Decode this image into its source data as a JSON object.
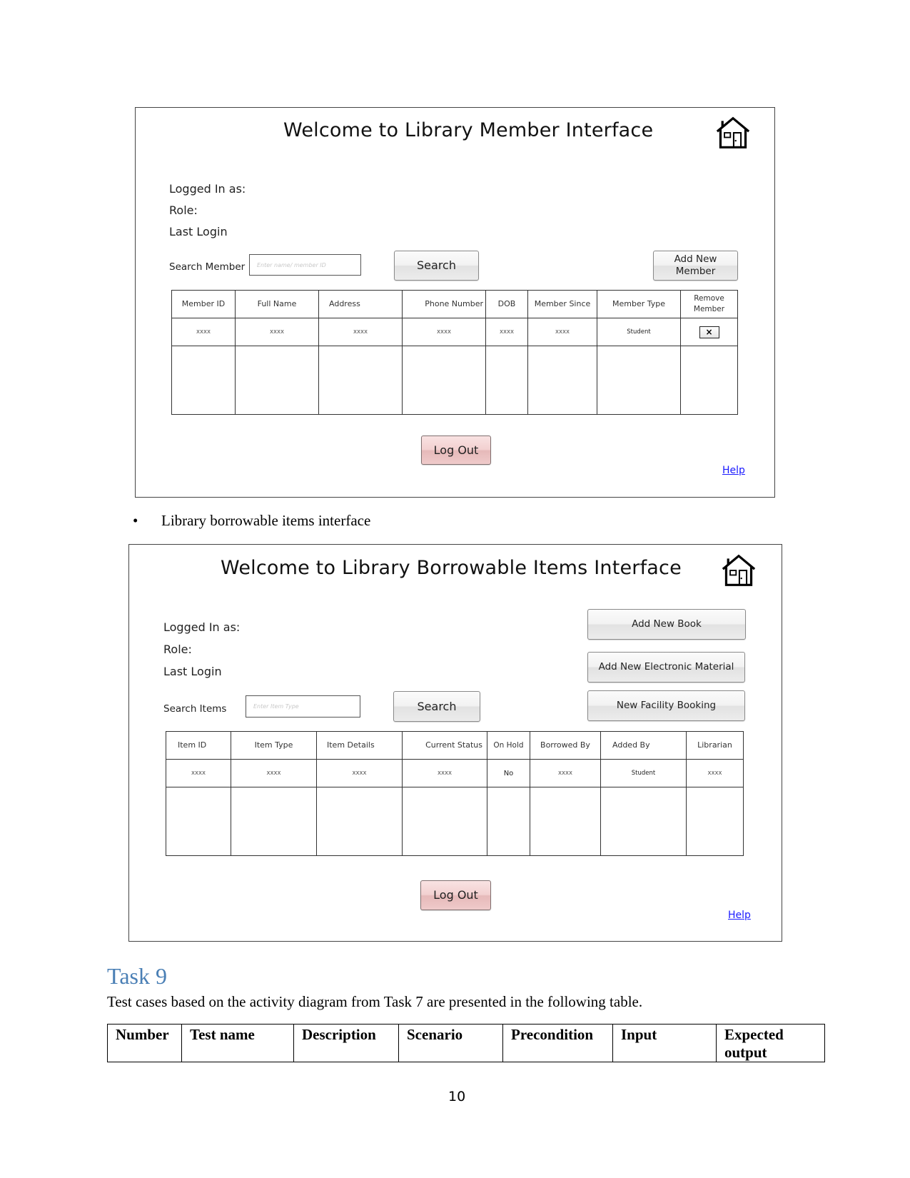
{
  "member_interface": {
    "title": "Welcome to Library Member Interface",
    "home_icon": "house-icon",
    "info": {
      "logged_in_as": "Logged In as:",
      "role": "Role:",
      "last_login": "Last Login"
    },
    "search": {
      "label": "Search Member",
      "placeholder": "Enter name/ member ID",
      "value": "",
      "button": "Search"
    },
    "add_button": "Add New Member",
    "table": {
      "headers": [
        "Member ID",
        "Full Name",
        "Address",
        "Phone Number",
        "DOB",
        "Member Since",
        "Member Type",
        "Remove Member"
      ],
      "rows": [
        [
          "xxxx",
          "xxxx",
          "xxxx",
          "xxxx",
          "xxxx",
          "xxxx",
          "Student",
          "×"
        ]
      ]
    },
    "logout_button": "Log Out",
    "help_link": "Help"
  },
  "bullet_text": "Library borrowable items interface",
  "items_interface": {
    "title": "Welcome to Library Borrowable Items Interface",
    "home_icon": "house-icon",
    "info": {
      "logged_in_as": "Logged In as:",
      "role": "Role:",
      "last_login": "Last Login"
    },
    "search": {
      "label": "Search Items",
      "placeholder": "Enter Item Type",
      "value": "",
      "button": "Search"
    },
    "action_buttons": [
      "Add New Book",
      "Add New Electronic Material",
      "New Facility Booking"
    ],
    "table": {
      "headers": [
        "Item ID",
        "Item Type",
        "Item Details",
        "Current Status",
        "On Hold",
        "Borrowed By",
        "Added By",
        "Librarian"
      ],
      "rows": [
        [
          "xxxx",
          "xxxx",
          "xxxx",
          "xxxx",
          "No",
          "xxxx",
          "Student",
          "xxxx"
        ]
      ]
    },
    "logout_button": "Log Out",
    "help_link": "Help"
  },
  "task": {
    "heading": "Task 9",
    "heading_color": "#4a7fb5",
    "intro": "Test cases based on the activity diagram from Task 7 are presented in the following table.",
    "table_headers": [
      "Number",
      "Test name",
      "Description",
      "Scenario",
      "Precondition",
      "Input",
      "Expected output"
    ]
  },
  "page_number": "10"
}
